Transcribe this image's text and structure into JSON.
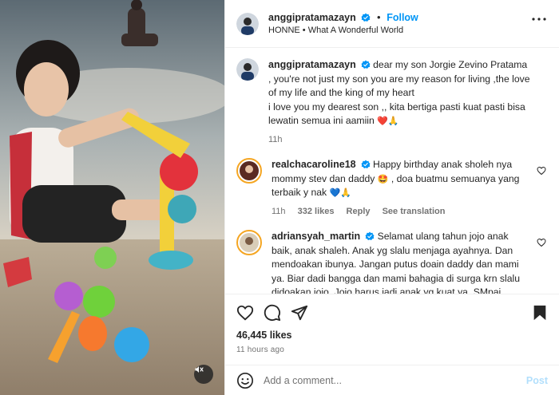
{
  "colors": {
    "accent": "#0095f6",
    "heart": "#ed4956",
    "text": "#262626",
    "muted": "#737373",
    "post_disabled": "#b2dffc"
  },
  "header": {
    "username": "anggipratamazayn",
    "follow_label": "Follow",
    "separator": "•",
    "audio": "HONNE • What A Wonderful World"
  },
  "caption": {
    "username": "anggipratamazayn",
    "text": "dear my son Jorgie Zevino Pratama , you're not just my son you are my reason for living ,the love of my life and the king of my heart",
    "text2": "i love you my dearest son ,, kita bertiga pasti kuat pasti bisa lewatin semua ini aamiin",
    "emojis": "❤️🙏",
    "time": "11h"
  },
  "comments": [
    {
      "username": "realchacaroline18",
      "text": "Happy birthday anak sholeh nya mommy stev dan daddy",
      "emoji_mid": "🤩",
      "text_after": ", doa buatmu semuanya yang terbaik y nak",
      "emoji_end": "💙🙏",
      "time": "11h",
      "likes": "332 likes",
      "reply": "Reply",
      "translate": "See translation"
    },
    {
      "username": "adriansyah_martin",
      "text": "Selamat ulang tahun jojo anak baik, anak shaleh. Anak yg slalu menjaga ayahnya. Dan mendoakan ibunya. Jangan putus doain daddy dan mami ya. Biar dadi bangga dan mami bahagia di surga krn slalu didoakan jojo. Jojo harus jadi anak yg kuat ya. SMpai ketemu besok. Om adri bawain kado buat jojo. Kesukaan jojo",
      "emoji_end": "❤️❤️"
    }
  ],
  "post": {
    "likes": "46,445 likes",
    "time_ago": "11 hours ago"
  },
  "add_comment": {
    "placeholder": "Add a comment...",
    "post_label": "Post"
  },
  "icons": [
    "mute-icon",
    "verified-icon",
    "more-icon",
    "heart-icon",
    "comment-icon",
    "share-icon",
    "bookmark-icon",
    "emoji-icon"
  ]
}
